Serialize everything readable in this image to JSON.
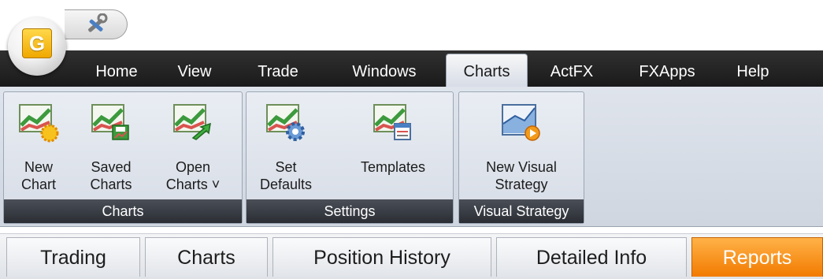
{
  "app": {
    "logo_letter": "G"
  },
  "quick_access": {
    "icon": "tools-icon"
  },
  "menu": {
    "items": [
      {
        "label": "Home"
      },
      {
        "label": "View"
      },
      {
        "label": "Trade"
      },
      {
        "label": "Windows"
      },
      {
        "label": "Charts",
        "active": true
      },
      {
        "label": "ActFX"
      },
      {
        "label": "FXApps"
      },
      {
        "label": "Help"
      }
    ]
  },
  "ribbon": {
    "groups": [
      {
        "title": "Charts",
        "buttons": [
          {
            "label": "New\nChart",
            "icon": "new-chart-icon"
          },
          {
            "label": "Saved\nCharts",
            "icon": "saved-charts-icon"
          },
          {
            "label": "Open\nCharts ˅",
            "icon": "open-charts-icon"
          }
        ]
      },
      {
        "title": "Settings",
        "buttons": [
          {
            "label": "Set\nDefaults",
            "icon": "set-defaults-icon"
          },
          {
            "label": "Templates",
            "icon": "templates-icon"
          }
        ]
      },
      {
        "title": "Visual Strategy",
        "buttons": [
          {
            "label": "New Visual\nStrategy",
            "icon": "new-visual-strategy-icon"
          }
        ]
      }
    ]
  },
  "bottom_tabs": [
    {
      "label": "Trading"
    },
    {
      "label": "Charts"
    },
    {
      "label": "Position History"
    },
    {
      "label": "Detailed Info"
    },
    {
      "label": "Reports",
      "active": true
    }
  ],
  "colors": {
    "menu_bar": "#1a1a1a",
    "active_tab": "#f27a00",
    "chart_green": "#4caf50",
    "chart_red": "#d9534f"
  }
}
